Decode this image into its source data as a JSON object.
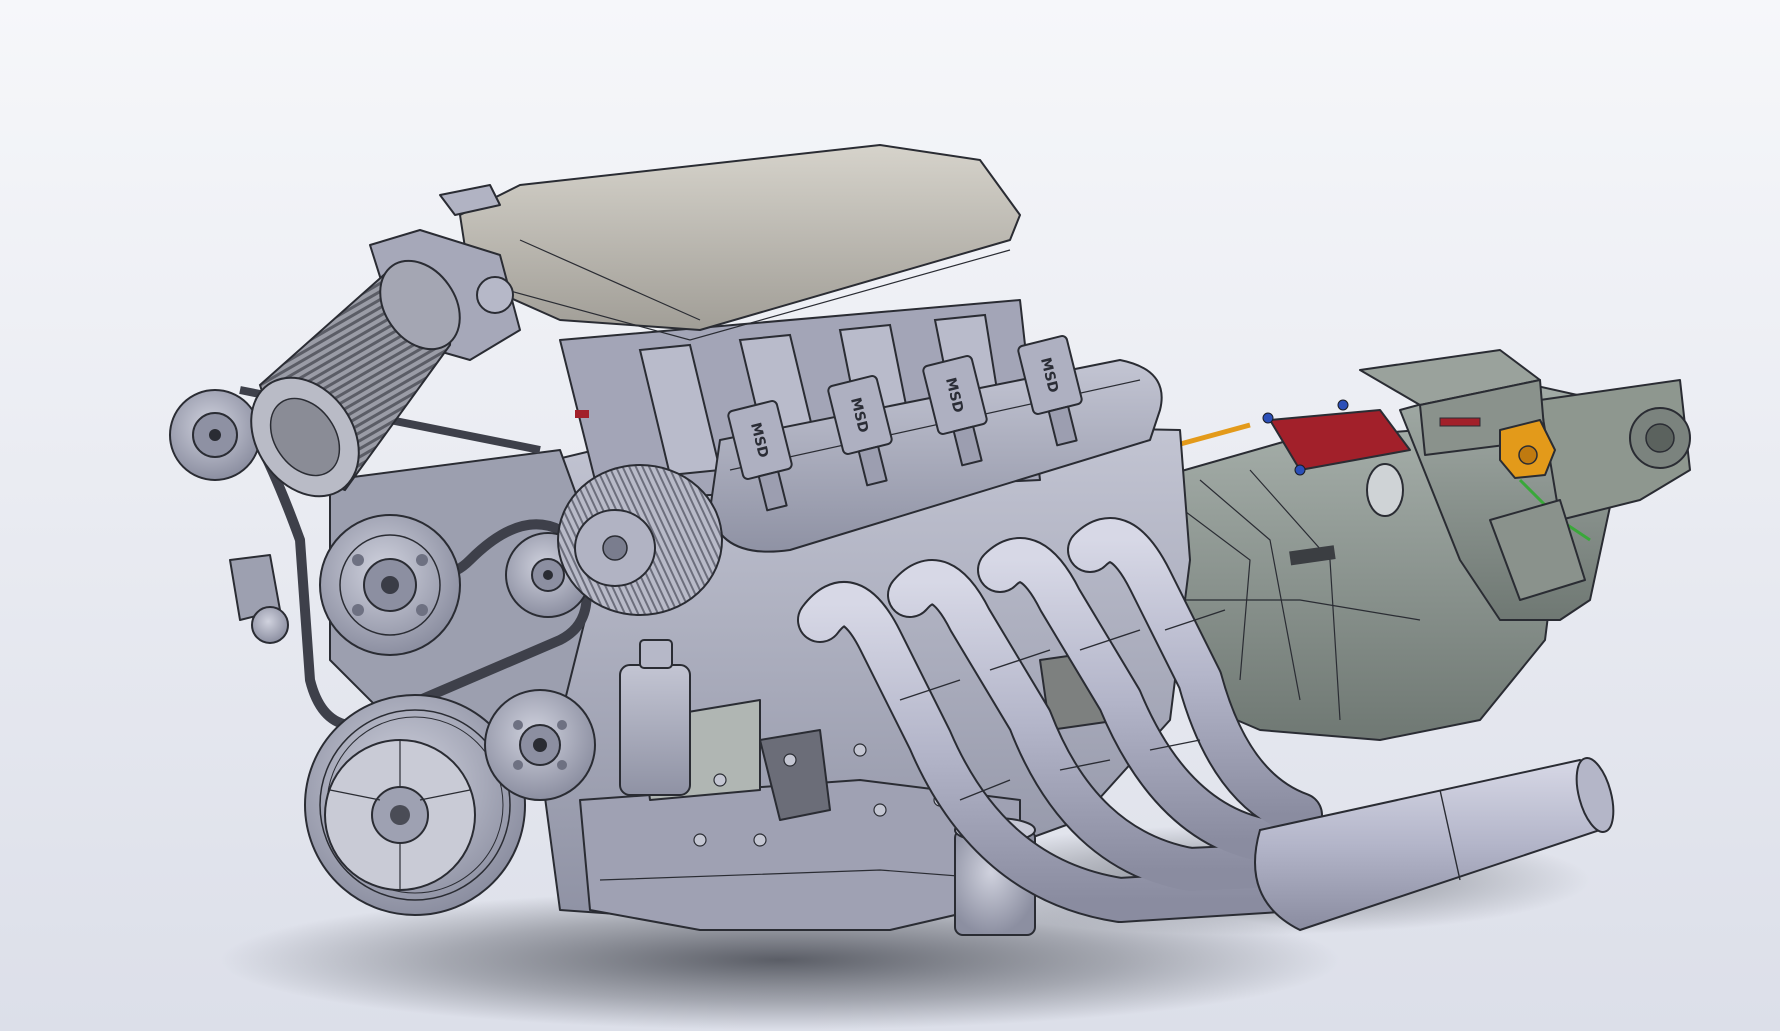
{
  "scene": {
    "background_top": "#f4f5f9",
    "background_bottom": "#dde0ea",
    "shadow_color": "#3a3d45"
  },
  "model": {
    "ignition_coil_labels": [
      "MSD",
      "MSD",
      "MSD",
      "MSD"
    ],
    "colors": {
      "engine_gray": "#a9abbd",
      "engine_light": "#c6c8d6",
      "engine_dark": "#7c7f90",
      "manifold_cover": "#b9b6ae",
      "transmission": "#8c9590",
      "sensor_red": "#a2202a",
      "bracket_orange": "#e39a1a",
      "fitting_blue": "#2b4fb8",
      "wire_green": "#3aa83a"
    },
    "icons": [
      "air-filter-icon",
      "pulley-icon",
      "alternator-icon",
      "ignition-coil-icon",
      "exhaust-header-icon",
      "transmission-icon"
    ]
  }
}
